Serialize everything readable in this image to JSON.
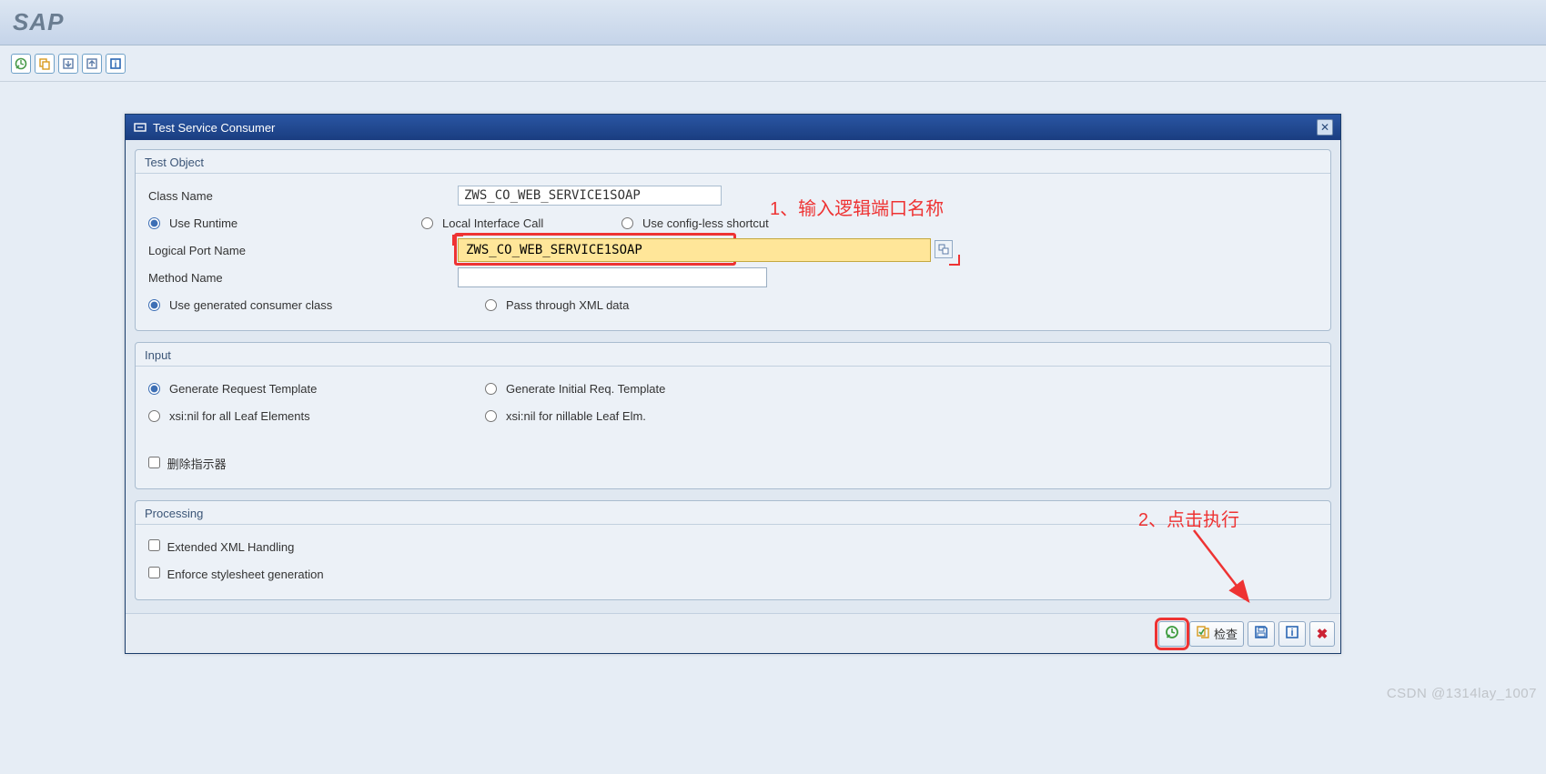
{
  "header": {
    "logo_text": "SAP"
  },
  "toolbar": {
    "icons": [
      "execute-icon",
      "copy-icon",
      "import-icon",
      "export-icon",
      "info-icon"
    ]
  },
  "dialog": {
    "title": "Test Service Consumer",
    "groups": {
      "test_object": {
        "title": "Test Object",
        "class_name_label": "Class Name",
        "class_name_value": "ZWS_CO_WEB_SERVICE1SOAP",
        "radio_use_runtime": "Use Runtime",
        "radio_local_call": "Local Interface Call",
        "radio_configless": "Use config-less shortcut",
        "logical_port_label": "Logical Port Name",
        "logical_port_value": "ZWS_CO_WEB_SERVICE1SOAP",
        "method_name_label": "Method Name",
        "method_name_value": "",
        "radio_gen_consumer": "Use generated consumer class",
        "radio_passthrough": "Pass through XML data"
      },
      "input": {
        "title": "Input",
        "radio_gen_req": "Generate Request Template",
        "radio_gen_init": "Generate Initial Req. Template",
        "radio_nil_all": "xsi:nil for all Leaf Elements",
        "radio_nil_nillable": "xsi:nil for nillable Leaf Elm.",
        "chk_delete_indicator": "删除指示器"
      },
      "processing": {
        "title": "Processing",
        "chk_ext_xml": "Extended XML Handling",
        "chk_enforce_xslt": "Enforce stylesheet generation"
      }
    },
    "footer": {
      "execute_label": "",
      "check_label": "检查"
    }
  },
  "annotations": {
    "a1": "1、输入逻辑端口名称",
    "a2": "2、点击执行"
  },
  "watermark": "CSDN @1314lay_1007"
}
